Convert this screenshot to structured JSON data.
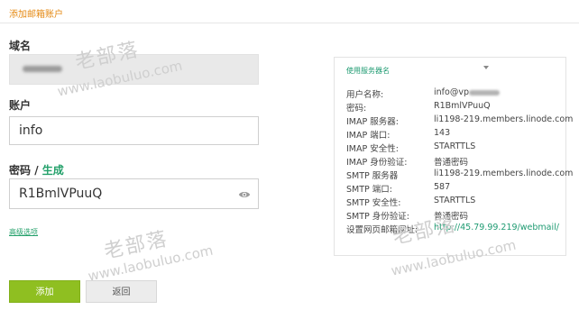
{
  "header": {
    "title": "添加邮箱账户"
  },
  "form": {
    "domain_label": "域名",
    "account_label": "账户",
    "account_value": "info",
    "password_label": "密码",
    "password_separator": "/",
    "generate_label": "生成",
    "password_value": "R1BmlVPuuQ",
    "advanced_label": "高级选项"
  },
  "buttons": {
    "add": "添加",
    "back": "返回"
  },
  "server_info": {
    "select_label": "使用服务器名",
    "rows": [
      {
        "key": "用户名称:",
        "value": "info@vp"
      },
      {
        "key": "密码:",
        "value": "R1BmlVPuuQ"
      },
      {
        "key": "IMAP 服务器:",
        "value": "li1198-219.members.linode.com"
      },
      {
        "key": "IMAP 端口:",
        "value": "143"
      },
      {
        "key": "IMAP 安全性:",
        "value": "STARTTLS"
      },
      {
        "key": "IMAP 身份验证:",
        "value": "普通密码"
      },
      {
        "key": "SMTP 服务器",
        "value": "li1198-219.members.linode.com"
      },
      {
        "key": "SMTP 端口:",
        "value": "587"
      },
      {
        "key": "SMTP 安全性:",
        "value": "STARTTLS"
      },
      {
        "key": "SMTP 身份验证:",
        "value": "普通密码"
      },
      {
        "key": "设置网页邮箱网址:",
        "value": "http://45.79.99.219/webmail/"
      }
    ]
  },
  "watermark": {
    "text_cn": "老部落",
    "url": "www.laobuluo.com"
  },
  "colors": {
    "accent_orange": "#e58a14",
    "accent_green": "#23a06a",
    "button_green": "#8fbf21"
  },
  "icons": [
    "eye-icon",
    "caret-down-icon"
  ]
}
